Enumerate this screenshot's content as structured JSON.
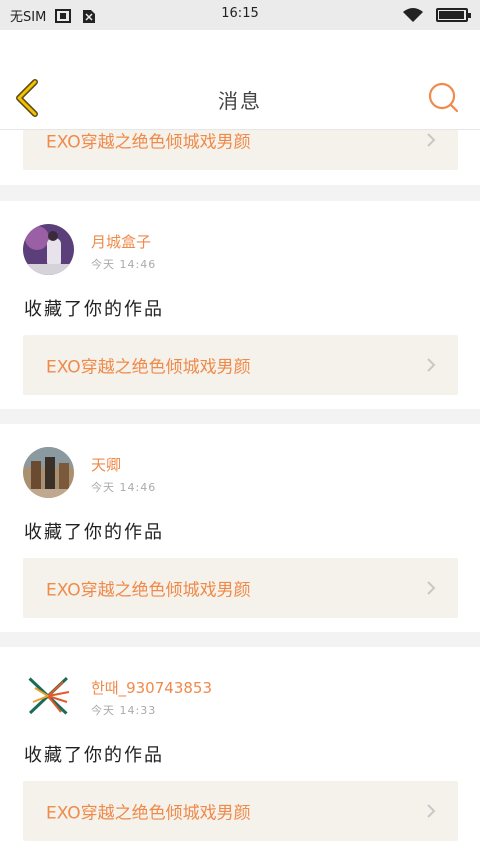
{
  "status_bar": {
    "carrier": "无SIM",
    "time": "16:15",
    "battery_level": 0.9
  },
  "header": {
    "title": "消息"
  },
  "top_partial_item": {
    "work_title": "EXO穿越之绝色倾城戏男颜"
  },
  "messages": [
    {
      "user_name": "月城盒子",
      "time": "今天 14:46",
      "action": "收藏了你的作品",
      "work_title": "EXO穿越之绝色倾城戏男颜"
    },
    {
      "user_name": "天卿",
      "time": "今天 14:46",
      "action": "收藏了你的作品",
      "work_title": "EXO穿越之绝色倾城戏男颜"
    },
    {
      "user_name": "한때_930743853",
      "time": "今天 14:33",
      "action": "收藏了你的作品",
      "work_title": "EXO穿越之绝色倾城戏男颜"
    }
  ],
  "colors": {
    "accent": "#f08a4b",
    "back_icon": "#e6b800",
    "work_box_bg": "#f4f2ea"
  },
  "icons": [
    "back-arrow-icon",
    "search-icon",
    "chevron-right-icon",
    "wifi-icon",
    "battery-icon",
    "screenshot-icon",
    "no-sim-icon"
  ]
}
